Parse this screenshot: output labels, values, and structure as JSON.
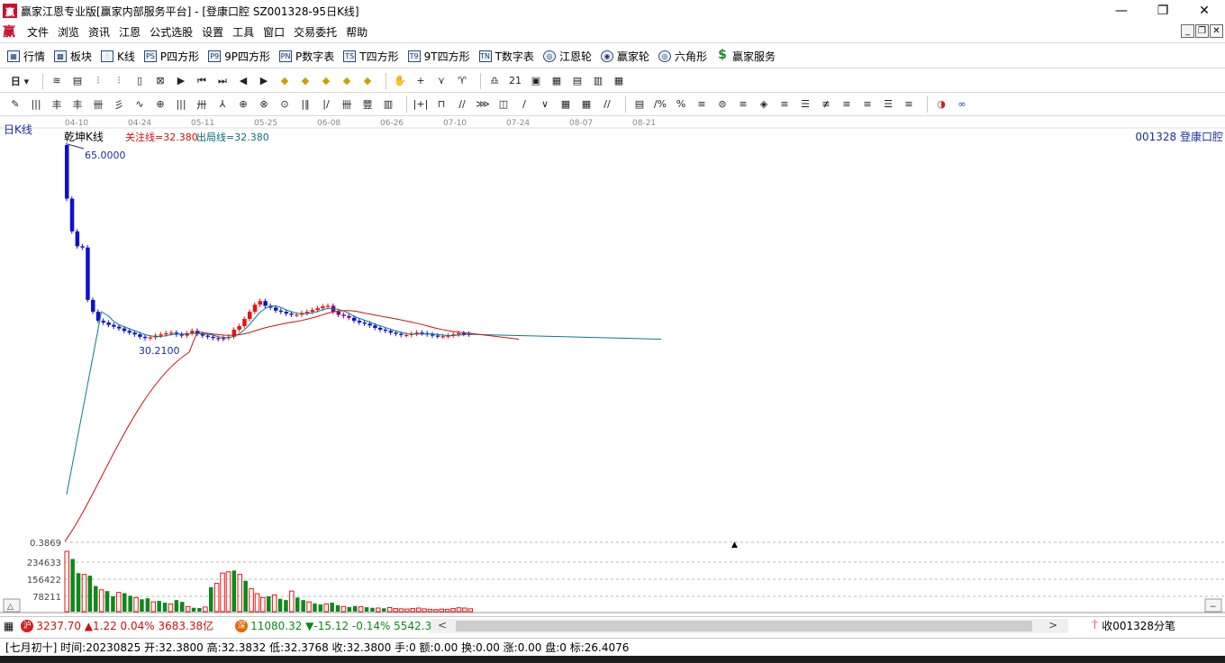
{
  "window": {
    "title": "赢家江恩专业版[赢家内部服务平台] - [登康口腔  SZ001328-95日K线]",
    "logo_text": "赢",
    "minimize": "—",
    "maximize": "❐",
    "close": "✕"
  },
  "menu": {
    "logo": "赢",
    "items": [
      "文件",
      "浏览",
      "资讯",
      "江恩",
      "公式选股",
      "设置",
      "工具",
      "窗口",
      "交易委托",
      "帮助"
    ],
    "mdi": [
      "_",
      "❐",
      "✕"
    ]
  },
  "toolbar1": {
    "items": [
      {
        "icon": "grid-icon",
        "glyph": "▦",
        "label": "行情"
      },
      {
        "icon": "blocks-icon",
        "glyph": "▩",
        "label": "板块"
      },
      {
        "icon": "candle-icon",
        "glyph": "⫶",
        "label": "K线"
      },
      {
        "icon": "ps-icon",
        "glyph": "PS",
        "label": "P四方形"
      },
      {
        "icon": "p9-icon",
        "glyph": "P9",
        "label": "9P四方形"
      },
      {
        "icon": "pn-icon",
        "glyph": "PN",
        "label": "P数字表"
      },
      {
        "icon": "ts-icon",
        "glyph": "TS",
        "label": "T四方形"
      },
      {
        "icon": "t9-icon",
        "glyph": "T9",
        "label": "9T四方形"
      },
      {
        "icon": "tn-icon",
        "glyph": "TN",
        "label": "T数字表"
      },
      {
        "icon": "gann-wheel-icon",
        "glyph": "◎",
        "label": "江恩轮"
      },
      {
        "icon": "winner-wheel-icon",
        "glyph": "◉",
        "label": "赢家轮"
      },
      {
        "icon": "hexagon-icon",
        "glyph": "◎",
        "label": "六角形"
      },
      {
        "icon": "dollar-icon",
        "glyph": "$",
        "label": "赢家服务"
      }
    ]
  },
  "toolbar2": {
    "period": "日",
    "icons": [
      "≋",
      "▤",
      "⫶",
      "⫶",
      "▯",
      "⊠",
      "▶",
      "⏮",
      "⏭",
      "◀",
      "▶",
      "◆",
      "◆",
      "◆",
      "◆",
      "◆",
      "✋",
      "+",
      "⋎",
      "♈",
      "♎",
      "21",
      "▣",
      "▦",
      "▤",
      "▥",
      "▦"
    ]
  },
  "toolbar3": {
    "icons": [
      "✎",
      "|||",
      "丰",
      "丰",
      "卌",
      "彡",
      "∿",
      "⊕",
      "|||",
      "卅",
      "⅄",
      "⊕",
      "⊗",
      "⊙",
      "|‖",
      "|∕",
      "卌",
      "豐",
      "▥",
      "|+|",
      "⊓",
      "∕∕",
      "⋙",
      "◫",
      "∕",
      "∨",
      "▦",
      "▦",
      "∕∕",
      "▤",
      "∕%",
      "%",
      "≡",
      "⊜",
      "≡",
      "◈",
      "≡",
      "☰",
      "≢",
      "≡",
      "≡",
      "☰",
      "≡",
      "◑",
      "∞"
    ]
  },
  "chart": {
    "period_label": "日K线",
    "stock_label": "001328  登康口腔",
    "indicator_name": "乾坤K线",
    "focus_line": "关注线=32.380",
    "exit_line": "出局线=32.380",
    "high_label": "65.0000",
    "low_label": "30.2100",
    "volume_ticks": [
      "0.3869",
      "234633",
      "156422",
      "78211"
    ],
    "x_dates": [
      "04-10",
      "04-24",
      "05-11",
      "05-25",
      "06-08",
      "06-26",
      "07-10",
      "07-24",
      "08-07",
      "08-21"
    ],
    "colors": {
      "up": "#ee1111",
      "down": "#1010d0",
      "vol_up": "#ee1111",
      "vol_down": "#0b8a1a",
      "ma_short": "#0a7a8a",
      "ma_long": "#d01010",
      "flat": "#800080"
    }
  },
  "chart_data": {
    "type": "candlestick",
    "price_range": [
      30.21,
      65.0
    ],
    "volume_ticks": [
      78211,
      156422,
      234633
    ],
    "candles_note": "daily K bars from 04-10 onward",
    "closes": [
      56.0,
      50.5,
      48.0,
      47.8,
      39.0,
      37.0,
      35.5,
      35.2,
      34.8,
      34.5,
      34.2,
      33.8,
      33.5,
      33.2,
      32.8,
      32.6,
      32.7,
      33.0,
      33.2,
      33.4,
      33.5,
      33.2,
      33.0,
      33.4,
      33.8,
      33.3,
      33.0,
      32.8,
      32.6,
      32.4,
      32.6,
      32.8,
      34.0,
      34.6,
      35.8,
      37.0,
      38.2,
      38.8,
      38.0,
      37.7,
      37.2,
      37.0,
      36.7,
      36.5,
      36.5,
      36.8,
      37.0,
      37.3,
      37.6,
      37.9,
      38.0,
      37.0,
      36.5,
      36.3,
      36.0,
      35.5,
      35.2,
      35.0,
      34.7,
      34.3,
      34.0,
      33.8,
      33.5,
      33.3,
      33.1,
      33.1,
      33.3,
      33.5,
      33.4,
      33.2,
      33.0,
      32.9,
      32.9,
      33.0,
      33.2,
      33.4,
      33.3,
      33.2
    ],
    "volumes": [
      234633,
      205000,
      150000,
      145000,
      140000,
      100000,
      85000,
      80000,
      60000,
      75000,
      72000,
      62000,
      55000,
      48000,
      52000,
      38000,
      42000,
      35000,
      30000,
      45000,
      38000,
      20000,
      15000,
      14000,
      18000,
      95000,
      110000,
      150000,
      155000,
      160000,
      145000,
      120000,
      90000,
      70000,
      55000,
      60000,
      65000,
      50000,
      45000,
      80000,
      55000,
      45000,
      38000,
      32000,
      28000,
      30000,
      35000,
      25000,
      20000,
      18000,
      22000,
      19000,
      17000,
      15000,
      14000,
      13000,
      16000,
      12000,
      11000,
      10000,
      12000,
      14000,
      11000,
      9000,
      8000,
      10000,
      9000,
      12000,
      15000,
      14000,
      11000
    ]
  },
  "bottom": {
    "sh_text": "3237.70 ▲1.22 0.04% 3683.38亿",
    "sh_badge": "沪",
    "sz_text": "11080.32 ▼-15.12 -0.14% 5542.38",
    "sz_badge": "深",
    "tick_link": "收001328分笔",
    "status": "[七月初十] 时间:20230825 开:32.3800 高:32.3832 低:32.3768 收:32.3800 手:0 额:0.00 换:0.00 涨:0.00 盘:0 标:26.4076"
  }
}
